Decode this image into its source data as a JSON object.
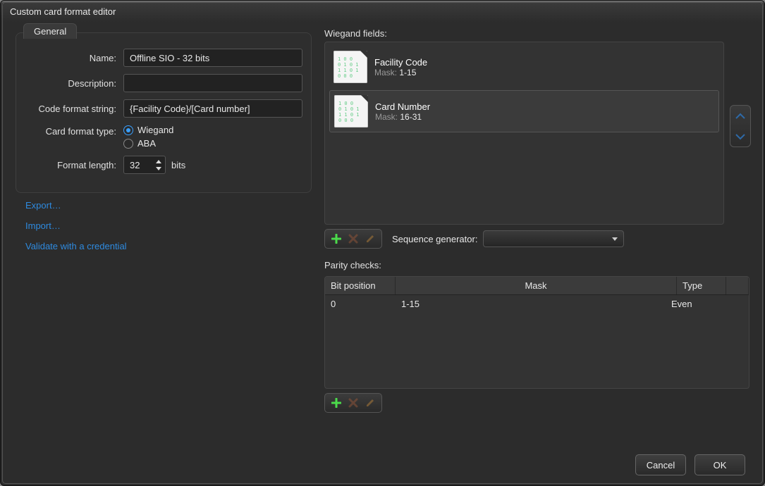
{
  "window": {
    "title": "Custom card format editor"
  },
  "general": {
    "tab": "General",
    "labels": {
      "name": "Name:",
      "description": "Description:",
      "code_format": "Code format string:",
      "card_format_type": "Card format type:",
      "format_length": "Format length:",
      "bits_unit": "bits"
    },
    "values": {
      "name": "Offline SIO - 32 bits",
      "description": "",
      "code_format": "{Facility Code}/[Card number]",
      "wiegand": "Wiegand",
      "aba": "ABA",
      "format_length": "32",
      "selected_type": "wiegand"
    }
  },
  "links": {
    "export": "Export…",
    "import": "Import…",
    "validate": "Validate with a credential"
  },
  "wiegand": {
    "title": "Wiegand fields:",
    "mask_label": "Mask:",
    "items": [
      {
        "title": "Facility Code",
        "mask": "1-15"
      },
      {
        "title": "Card Number",
        "mask": "16-31"
      }
    ]
  },
  "seq": {
    "label": "Sequence generator:",
    "selected": ""
  },
  "parity": {
    "title": "Parity checks:",
    "columns": {
      "bit": "Bit position",
      "mask": "Mask",
      "type": "Type"
    },
    "rows": [
      {
        "bit": "0",
        "mask": "1-15",
        "type": "Even"
      }
    ]
  },
  "footer": {
    "cancel": "Cancel",
    "ok": "OK"
  }
}
